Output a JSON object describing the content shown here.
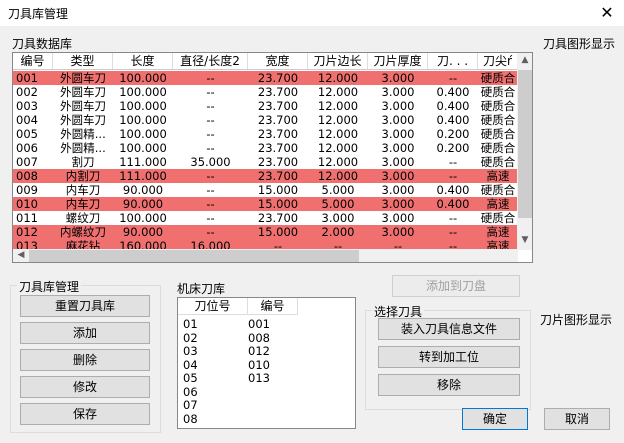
{
  "window": {
    "title": "刀具库管理",
    "close": "✕"
  },
  "db_label": "刀具数据库",
  "graphic_label": "刀具图形显示",
  "blade_graphic_label": "刀片图形显示",
  "table": {
    "columns": [
      "编号",
      "类型",
      "长度",
      "直径/长度2",
      "宽度",
      "刀片边长",
      "刀片厚度",
      "刀. . .",
      "刀尖ŕ"
    ],
    "rows": [
      {
        "highlight": true,
        "cells": [
          "001",
          "外圆车刀",
          "100.000",
          "--",
          "23.700",
          "12.000",
          "3.000",
          "--",
          "硬质合"
        ]
      },
      {
        "highlight": false,
        "cells": [
          "002",
          "外圆车刀",
          "100.000",
          "--",
          "23.700",
          "12.000",
          "3.000",
          "0.400",
          "硬质合"
        ]
      },
      {
        "highlight": false,
        "cells": [
          "003",
          "外圆车刀",
          "100.000",
          "--",
          "23.700",
          "12.000",
          "3.000",
          "0.400",
          "硬质合"
        ]
      },
      {
        "highlight": false,
        "cells": [
          "004",
          "外圆车刀",
          "100.000",
          "--",
          "23.700",
          "12.000",
          "3.000",
          "0.400",
          "硬质合"
        ]
      },
      {
        "highlight": false,
        "cells": [
          "005",
          "外圆精...",
          "100.000",
          "--",
          "23.700",
          "12.000",
          "3.000",
          "0.200",
          "硬质合"
        ]
      },
      {
        "highlight": false,
        "cells": [
          "006",
          "外圆精...",
          "100.000",
          "--",
          "23.700",
          "12.000",
          "3.000",
          "0.200",
          "硬质合"
        ]
      },
      {
        "highlight": false,
        "cells": [
          "007",
          "割刀",
          "111.000",
          "35.000",
          "23.700",
          "12.000",
          "3.000",
          "--",
          "硬质合"
        ]
      },
      {
        "highlight": true,
        "cells": [
          "008",
          "内割刀",
          "111.000",
          "--",
          "23.700",
          "12.000",
          "3.000",
          "--",
          "高速"
        ]
      },
      {
        "highlight": false,
        "cells": [
          "009",
          "内车刀",
          "90.000",
          "--",
          "15.000",
          "5.000",
          "3.000",
          "0.400",
          "硬质合"
        ]
      },
      {
        "highlight": true,
        "cells": [
          "010",
          "内车刀",
          "90.000",
          "--",
          "15.000",
          "5.000",
          "3.000",
          "0.400",
          "高速"
        ]
      },
      {
        "highlight": false,
        "cells": [
          "011",
          "螺纹刀",
          "100.000",
          "--",
          "23.700",
          "3.000",
          "3.000",
          "--",
          "硬质合"
        ]
      },
      {
        "highlight": true,
        "cells": [
          "012",
          "内螺纹刀",
          "90.000",
          "--",
          "15.000",
          "2.000",
          "3.000",
          "--",
          "高速"
        ]
      },
      {
        "highlight": true,
        "cells": [
          "013",
          "麻花钻",
          "160.000",
          "16.000",
          "--",
          "--",
          "--",
          "--",
          "高速"
        ]
      }
    ]
  },
  "lib_mgmt": {
    "title": "刀具库管理",
    "buttons": [
      "重置刀具库",
      "添加",
      "删除",
      "修改",
      "保存"
    ]
  },
  "machine_lib": {
    "title": "机床刀库",
    "columns": [
      "刀位号",
      "编号"
    ],
    "rows": [
      [
        "01",
        "001"
      ],
      [
        "02",
        "008"
      ],
      [
        "03",
        "012"
      ],
      [
        "04",
        "010"
      ],
      [
        "05",
        "013"
      ],
      [
        "06",
        ""
      ],
      [
        "07",
        ""
      ],
      [
        "08",
        ""
      ]
    ]
  },
  "add_to_disk": "添加到刀盘",
  "select_tool": {
    "title": "选择刀具",
    "buttons": [
      "装入刀具信息文件",
      "转到加工位",
      "移除"
    ]
  },
  "ok": "确定",
  "cancel": "取消",
  "colors": {
    "highlight": "#f07070"
  }
}
